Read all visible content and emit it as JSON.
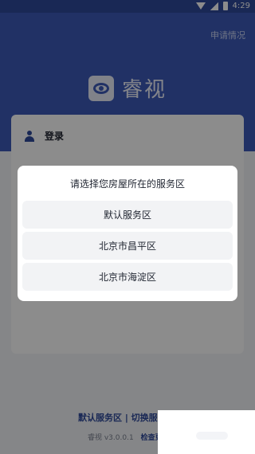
{
  "status_bar": {
    "time": "4:29"
  },
  "header": {
    "apply_link": "申请情况",
    "logo_text": "睿视"
  },
  "main": {
    "login_label": "登录"
  },
  "footer": {
    "links": "默认服务区 | 切换服",
    "version": "睿视 v3.0.0.1",
    "check": "检查更"
  },
  "dialog": {
    "title": "请选择您房屋所在的服务区",
    "options": [
      "默认服务区",
      "北京市昌平区",
      "北京市海淀区"
    ]
  },
  "colors": {
    "primary": "#3c5ab9",
    "status_bar": "#2f4a9c",
    "overlay": "rgba(0,0,0,0.45)"
  }
}
